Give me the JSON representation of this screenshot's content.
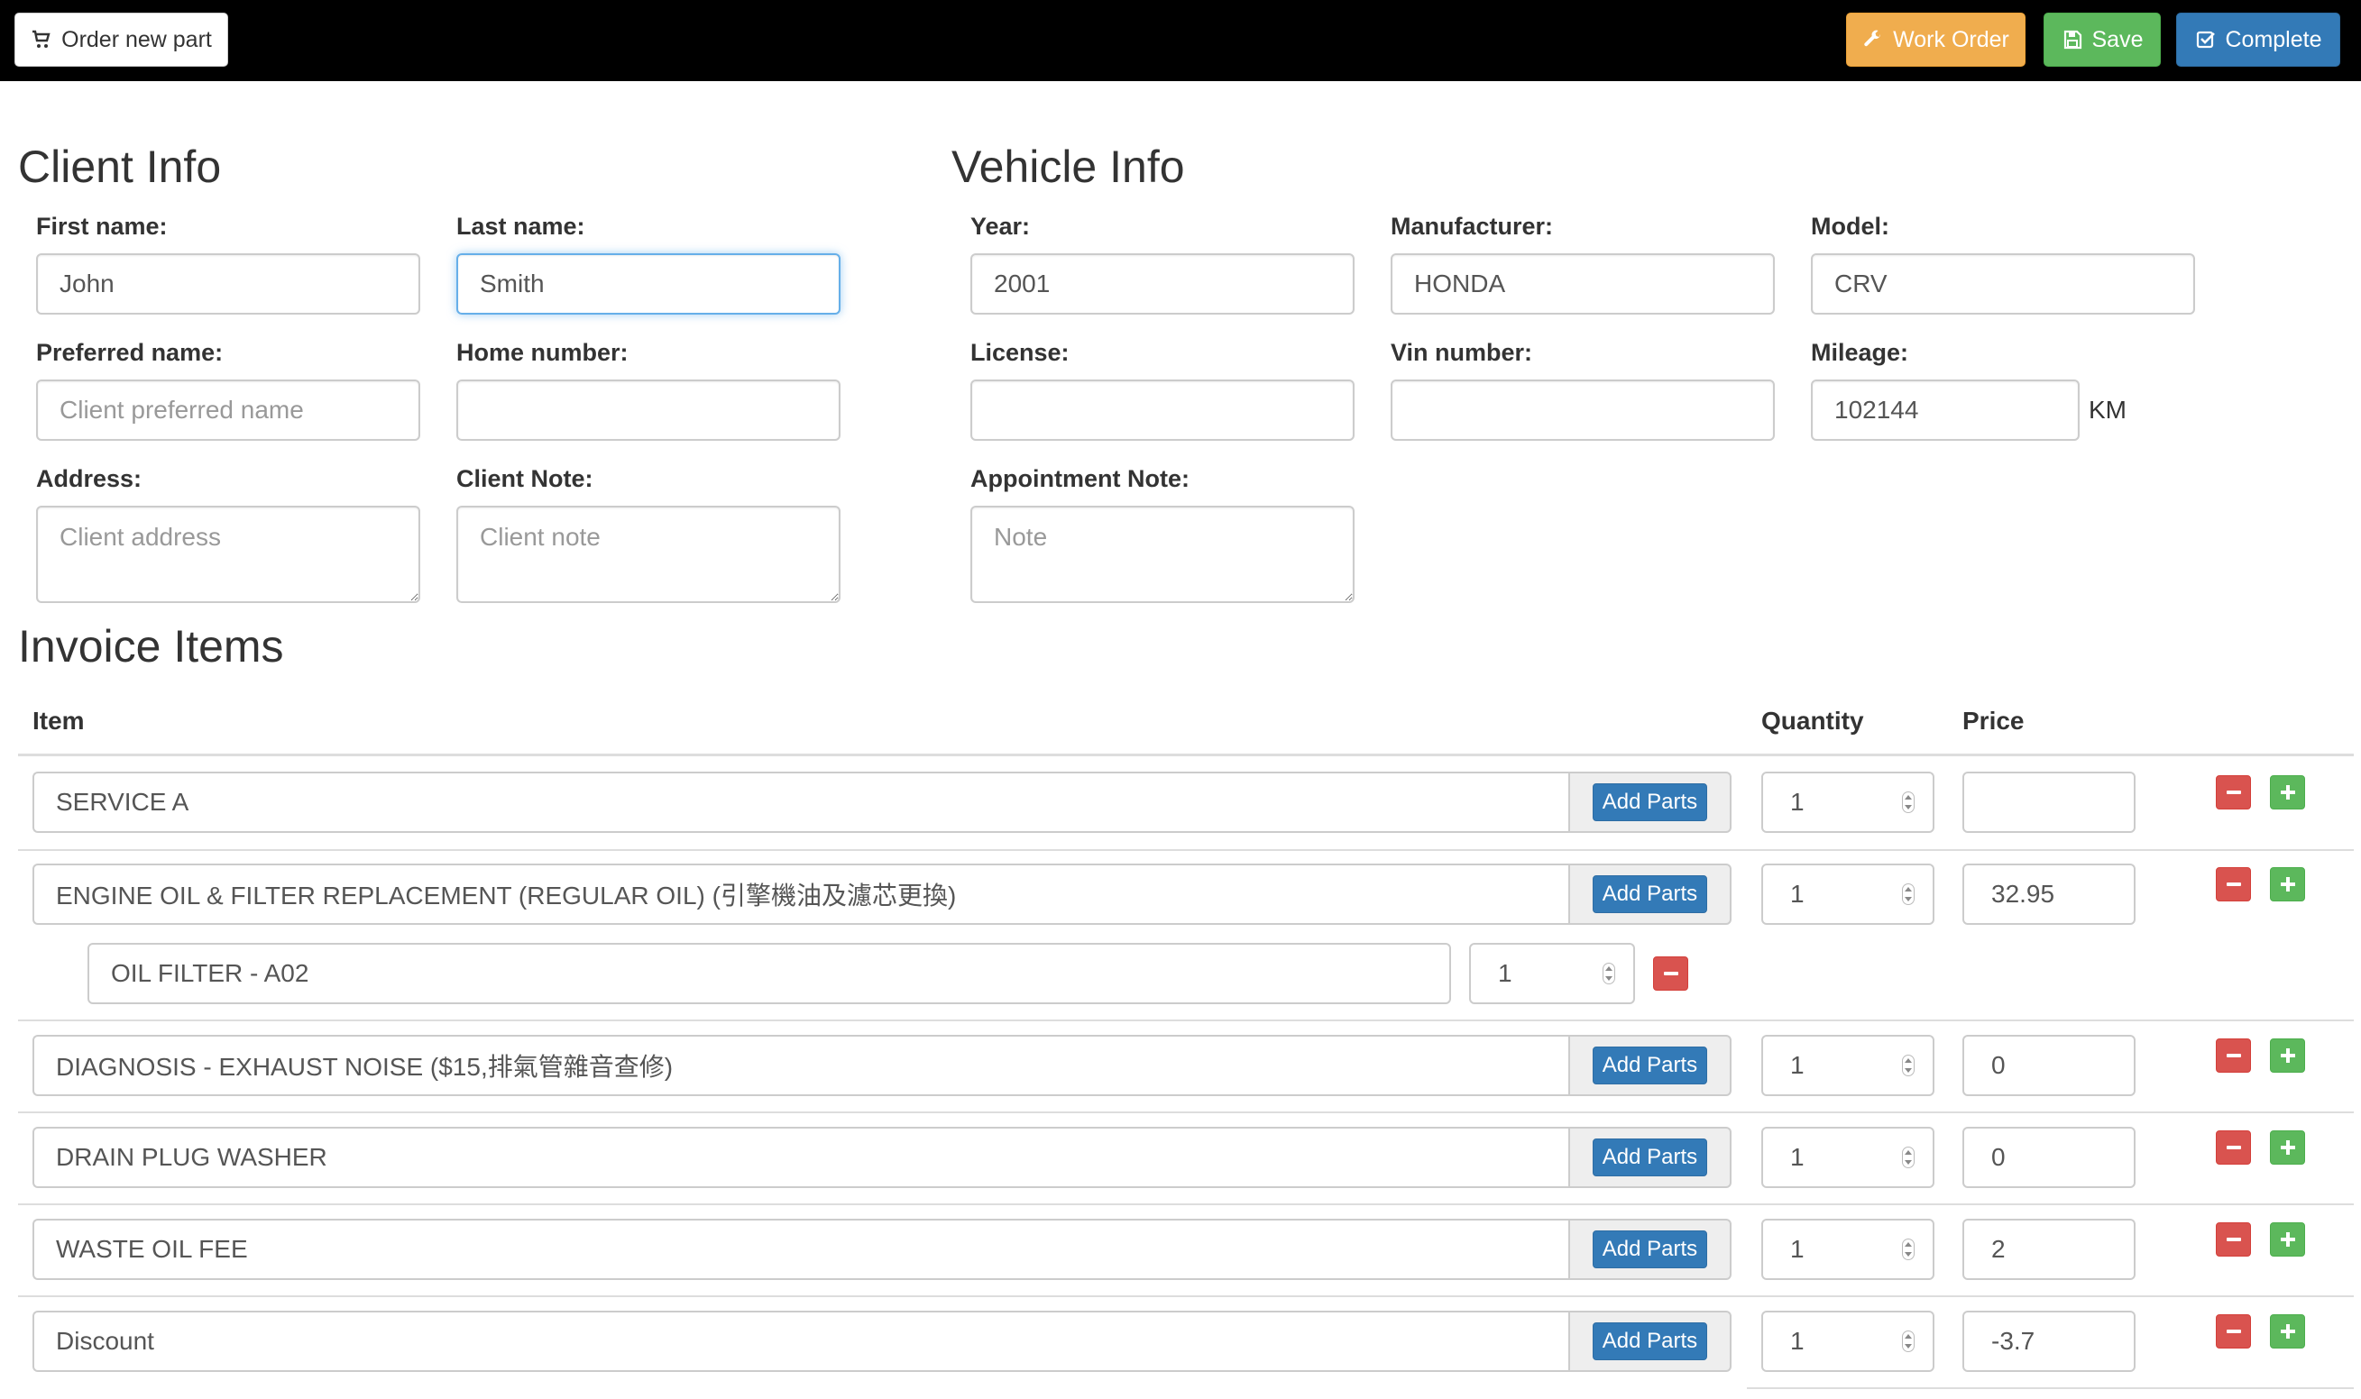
{
  "toolbar": {
    "order_new_part": "Order new part",
    "work_order": "Work Order",
    "save": "Save",
    "complete": "Complete"
  },
  "client": {
    "heading": "Client Info",
    "first_name_label": "First name:",
    "first_name_value": "John",
    "last_name_label": "Last name:",
    "last_name_value": "Smith",
    "preferred_label": "Preferred name:",
    "preferred_placeholder": "Client preferred name",
    "home_label": "Home number:",
    "address_label": "Address:",
    "address_placeholder": "Client address",
    "note_label": "Client Note:",
    "note_placeholder": "Client note"
  },
  "vehicle": {
    "heading": "Vehicle Info",
    "year_label": "Year:",
    "year_value": "2001",
    "manufacturer_label": "Manufacturer:",
    "manufacturer_value": "HONDA",
    "model_label": "Model:",
    "model_value": "CRV",
    "license_label": "License:",
    "vin_label": "Vin number:",
    "mileage_label": "Mileage:",
    "mileage_value": "102144",
    "mileage_unit": "KM",
    "appt_label": "Appointment Note:",
    "appt_placeholder": "Note"
  },
  "invoice": {
    "heading": "Invoice Items",
    "col_item": "Item",
    "col_quantity": "Quantity",
    "col_price": "Price",
    "add_parts_label": "Add Parts",
    "items": [
      {
        "name": "SERVICE A",
        "qty": "1",
        "price": ""
      },
      {
        "name": "ENGINE OIL & FILTER REPLACEMENT (REGULAR OIL) (引擎機油及濾芯更換)",
        "qty": "1",
        "price": "32.95",
        "parts": [
          {
            "name": "OIL FILTER - A02",
            "qty": "1"
          }
        ]
      },
      {
        "name": "DIAGNOSIS - EXHAUST NOISE ($15,排氣管雜音查修)",
        "qty": "1",
        "price": "0"
      },
      {
        "name": "DRAIN PLUG WASHER",
        "qty": "1",
        "price": "0"
      },
      {
        "name": "WASTE OIL FEE",
        "qty": "1",
        "price": "2"
      },
      {
        "name": "Discount",
        "qty": "1",
        "price": "-3.7"
      }
    ]
  },
  "colors": {
    "topbar": "#000000",
    "warning": "#f0ad4e",
    "success": "#5cb85c",
    "primary": "#337ab7",
    "danger": "#d9534f"
  }
}
